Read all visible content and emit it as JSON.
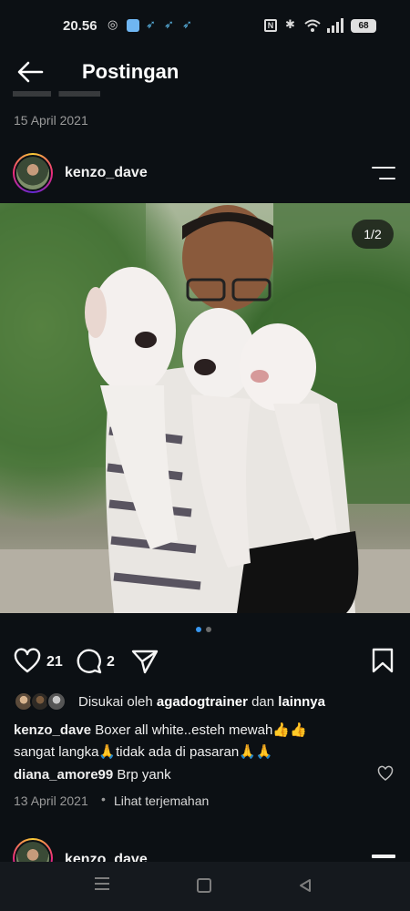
{
  "status_bar": {
    "time": "20.56",
    "icons": [
      "whatsapp-icon",
      "app-icon",
      "bird-icon",
      "bird-icon",
      "bird-icon",
      "nfc-icon",
      "bluetooth-icon",
      "wifi-icon",
      "signal-icon"
    ],
    "battery": "68"
  },
  "header": {
    "title": "Postingan"
  },
  "previous_post": {
    "date": "15 April 2021"
  },
  "post": {
    "username": "kenzo_dave",
    "image_counter": "1/2",
    "likes": "21",
    "comments": "2",
    "liked_by_prefix": "Disukai oleh",
    "liked_by_user": "agadogtrainer",
    "liked_by_joiner": "dan",
    "liked_by_others": "lainnya",
    "caption_user": "kenzo_dave",
    "caption_line1": "Boxer all white..esteh mewah👍👍",
    "caption_line2": "sangat langka🙏tidak ada di pasaran🙏🙏",
    "comment_user": "diana_amore99",
    "comment_text": "Brp yank",
    "date": "13 April 2021",
    "separator": "•",
    "translate": "Lihat terjemahan"
  },
  "next_post": {
    "username": "kenzo_dave"
  },
  "colors": {
    "background": "#0c1014",
    "active_dot": "#3897f0",
    "inactive_dot": "#6b6b6b"
  }
}
